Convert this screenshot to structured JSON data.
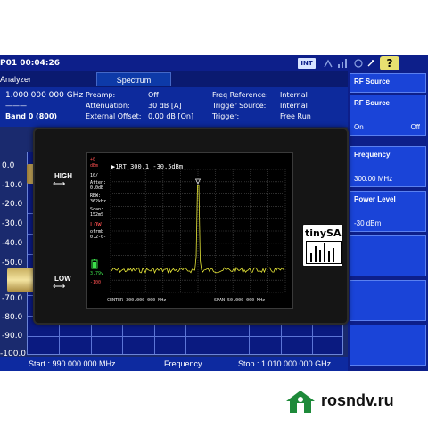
{
  "analyzer": {
    "datetime": "P01 00:04:26",
    "int_badge": "INT",
    "help_label": "?",
    "mode_name": "Analyzer",
    "tab_label": "Spectrum",
    "params": {
      "center_freq": "1.000 000 000 GHz",
      "center_sub": "———",
      "band": "Band 0 (800)",
      "preamp_label": "Preamp:",
      "preamp_value": "Off",
      "atten_label": "Attenuation:",
      "atten_value": "30 dB  [A]",
      "offset_label": "External Offset:",
      "offset_value": "0.00 dB  [On]",
      "freqref_label": "Freq Reference:",
      "freqref_value": "Internal",
      "trigsrc_label": "Trigger Source:",
      "trigsrc_value": "Internal",
      "trig_label": "Trigger:",
      "trig_value": "Free Run"
    },
    "y_labels": [
      "0.0",
      "-10.0",
      "-20.0",
      "-30.0",
      "-40.0",
      "-50.0",
      "-70.0",
      "-80.0",
      "-90.0",
      "-100.0"
    ],
    "start_label": "Start : 990.000 000 MHz",
    "center_label": "Frequency",
    "stop_label": "Stop : 1.010 000 000 GHz"
  },
  "softkeys": {
    "header": "RF Source",
    "rf_source_title": "RF Source",
    "rf_on": "On",
    "rf_off": "Off",
    "frequency_title": "Frequency",
    "frequency_value": "300.00 MHz",
    "power_title": "Power Level",
    "power_value": "-30 dBm"
  },
  "device": {
    "high_label": "HIGH",
    "low_label": "LOW",
    "marker_readout": "▶1RT 300.1 -30.5dBm",
    "side": {
      "ref": "+0",
      "ref_unit": "dBm",
      "scale": "10/",
      "atten": "Atten:",
      "atten_val": "0.0dB",
      "rbw": "RBW:",
      "rbw_val": "362kHz",
      "scan": "Scan:",
      "scan_val": "152mS",
      "mode": "LOW",
      "offset": "ofrmb",
      "offset_val": "0.2-0-",
      "battery": "3.79v",
      "bottom": "-100"
    },
    "center_label": "CENTER 300.000 000 MHz",
    "span_label": "SPAN 50.000 000 MHz",
    "logo_text": "tinySA",
    "trace_color": "#e8e838",
    "marker_color": "#ffffff"
  },
  "watermark": {
    "text": "rosndv.ru",
    "icon": "house-icon",
    "icon_color": "#1e8a3a"
  }
}
